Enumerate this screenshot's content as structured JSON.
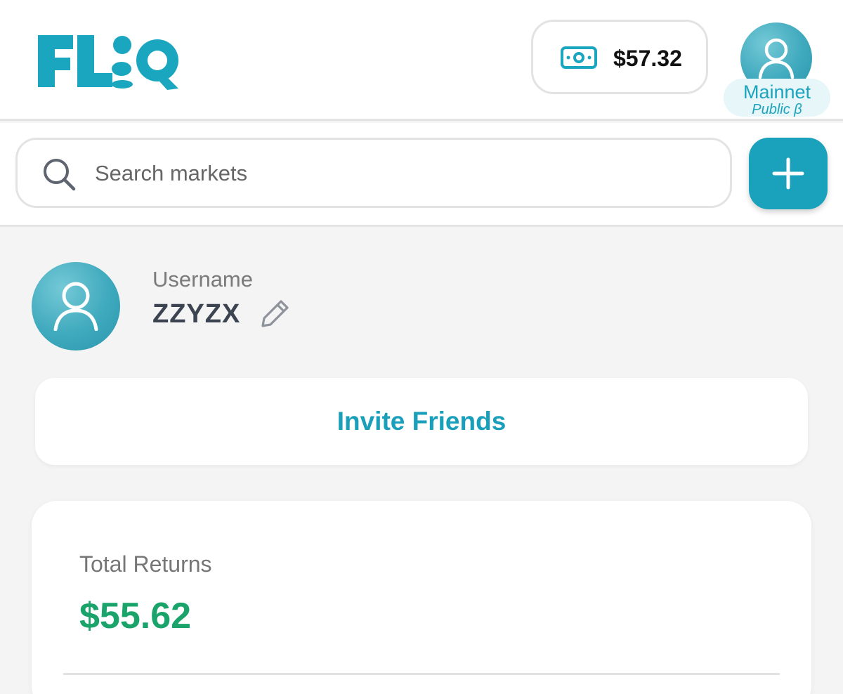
{
  "header": {
    "logo_text": "FLIQ",
    "balance": "$57.32",
    "network": {
      "name": "Mainnet",
      "subtitle": "Public β"
    }
  },
  "search": {
    "placeholder": "Search markets",
    "value": ""
  },
  "profile": {
    "username_label": "Username",
    "username": "ZZYZX"
  },
  "invite": {
    "label": "Invite Friends"
  },
  "returns": {
    "label": "Total Returns",
    "value": "$55.62"
  },
  "icons": {
    "cash": "cash-icon",
    "avatar": "user-icon",
    "search": "search-icon",
    "add": "plus-icon",
    "edit": "pencil-icon"
  },
  "colors": {
    "brand": "#1aa2bc",
    "positive": "#1aa36a",
    "background": "#f4f4f4"
  }
}
